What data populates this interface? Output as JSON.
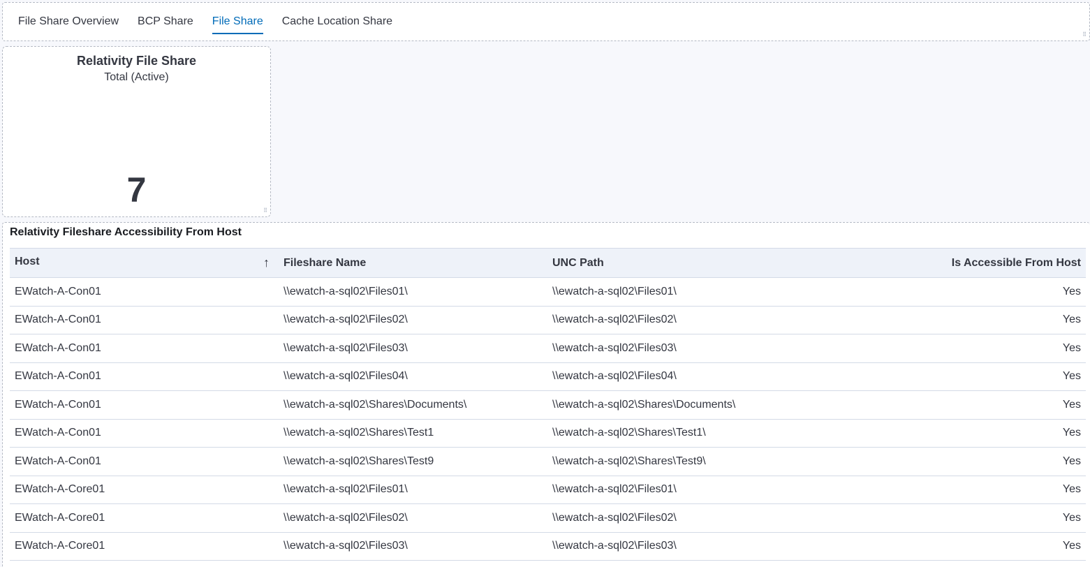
{
  "tabs": [
    {
      "label": "File Share Overview",
      "active": false
    },
    {
      "label": "BCP Share",
      "active": false
    },
    {
      "label": "File Share",
      "active": true
    },
    {
      "label": "Cache Location Share",
      "active": false
    }
  ],
  "metric": {
    "title": "Relativity File Share",
    "subtitle": "Total (Active)",
    "value": "7"
  },
  "table": {
    "title": "Relativity Fileshare Accessibility From Host",
    "columns": [
      "Host",
      "Fileshare Name",
      "UNC Path",
      "Is Accessible From Host"
    ],
    "sort_icon": "arrow-up-icon",
    "rows": [
      [
        "EWatch-A-Con01",
        "\\\\ewatch-a-sql02\\Files01\\",
        "\\\\ewatch-a-sql02\\Files01\\",
        "Yes"
      ],
      [
        "EWatch-A-Con01",
        "\\\\ewatch-a-sql02\\Files02\\",
        "\\\\ewatch-a-sql02\\Files02\\",
        "Yes"
      ],
      [
        "EWatch-A-Con01",
        "\\\\ewatch-a-sql02\\Files03\\",
        "\\\\ewatch-a-sql02\\Files03\\",
        "Yes"
      ],
      [
        "EWatch-A-Con01",
        "\\\\ewatch-a-sql02\\Files04\\",
        "\\\\ewatch-a-sql02\\Files04\\",
        "Yes"
      ],
      [
        "EWatch-A-Con01",
        "\\\\ewatch-a-sql02\\Shares\\Documents\\",
        "\\\\ewatch-a-sql02\\Shares\\Documents\\",
        "Yes"
      ],
      [
        "EWatch-A-Con01",
        "\\\\ewatch-a-sql02\\Shares\\Test1",
        "\\\\ewatch-a-sql02\\Shares\\Test1\\",
        "Yes"
      ],
      [
        "EWatch-A-Con01",
        "\\\\ewatch-a-sql02\\Shares\\Test9",
        "\\\\ewatch-a-sql02\\Shares\\Test9\\",
        "Yes"
      ],
      [
        "EWatch-A-Core01",
        "\\\\ewatch-a-sql02\\Files01\\",
        "\\\\ewatch-a-sql02\\Files01\\",
        "Yes"
      ],
      [
        "EWatch-A-Core01",
        "\\\\ewatch-a-sql02\\Files02\\",
        "\\\\ewatch-a-sql02\\Files02\\",
        "Yes"
      ],
      [
        "EWatch-A-Core01",
        "\\\\ewatch-a-sql02\\Files03\\",
        "\\\\ewatch-a-sql02\\Files03\\",
        "Yes"
      ]
    ]
  }
}
